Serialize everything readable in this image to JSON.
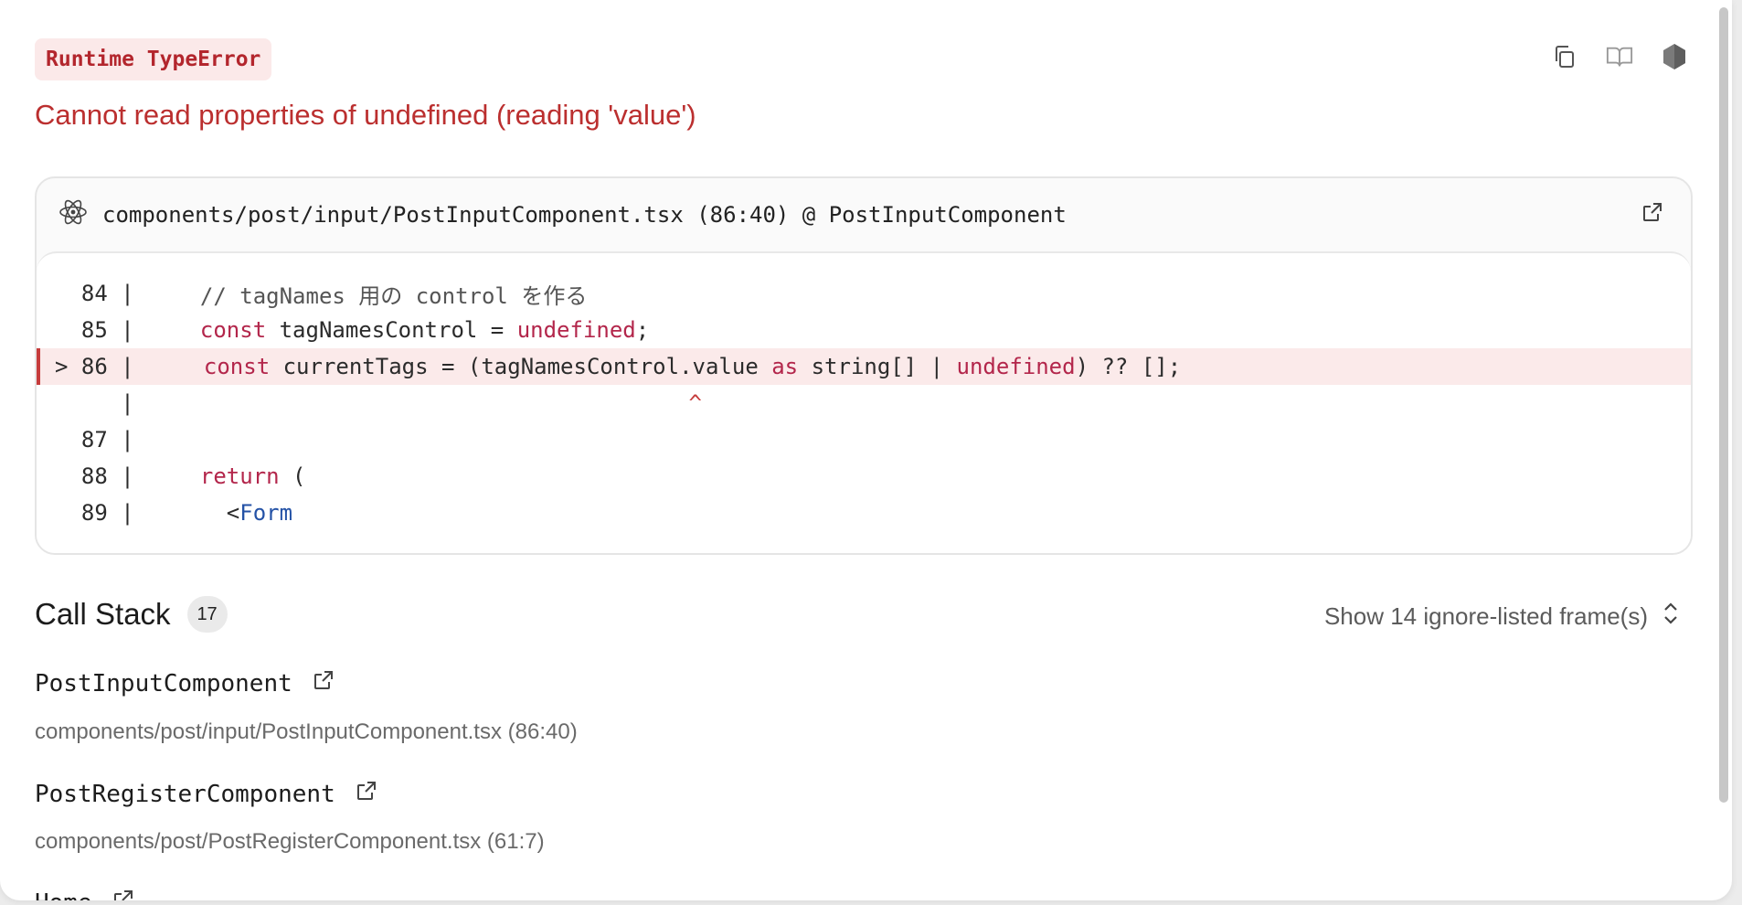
{
  "error": {
    "type_badge": "Runtime TypeError",
    "message": "Cannot read properties of undefined (reading 'value')"
  },
  "toolbar": {
    "icons": [
      "copy-icon",
      "docs-book-icon",
      "nextjs-hexagon-icon"
    ]
  },
  "code_frame": {
    "file_label": "components/post/input/PostInputComponent.tsx (86:40) @ PostInputComponent",
    "lines": [
      {
        "num": "  84 | ",
        "text": "  // tagNames 用の control を作る"
      },
      {
        "num": "  85 | ",
        "text": "  const tagNamesControl = undefined;"
      },
      {
        "num": "> 86 | ",
        "text": "  const currentTags = (tagNamesControl.value as string[] | undefined) ?? [];"
      },
      {
        "num": "     | ",
        "text": "                                       ^"
      },
      {
        "num": "  87 | ",
        "text": ""
      },
      {
        "num": "  88 | ",
        "text": "  return ("
      },
      {
        "num": "  89 | ",
        "text": "    <Form"
      }
    ]
  },
  "call_stack": {
    "title": "Call Stack",
    "count": "17",
    "show_ignored": "Show 14 ignore-listed frame(s)",
    "frames": [
      {
        "name": "PostInputComponent",
        "location": "components/post/input/PostInputComponent.tsx (86:40)"
      },
      {
        "name": "PostRegisterComponent",
        "location": "components/post/PostRegisterComponent.tsx (61:7)"
      },
      {
        "name": "Home",
        "location": ""
      }
    ]
  },
  "colors": {
    "error_red": "#bb2f2f",
    "badge_bg": "#fbe9e9",
    "highlight_bg": "#fbeaea",
    "keyword": "#b3264b",
    "jsx_tag": "#2452a6"
  }
}
